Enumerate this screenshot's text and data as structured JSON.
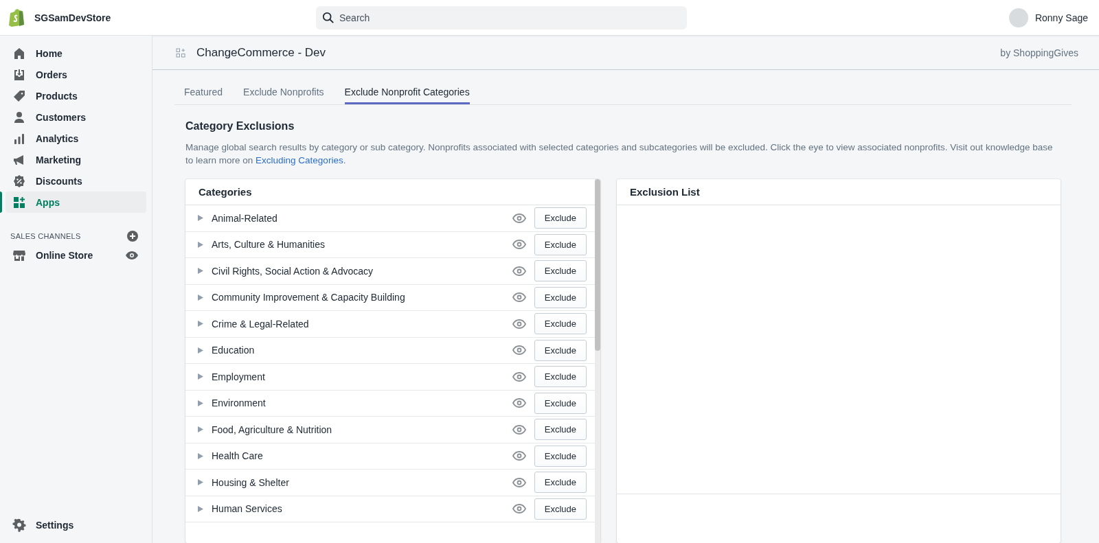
{
  "topbar": {
    "store_name": "SGSamDevStore",
    "search": {
      "placeholder": "Search"
    },
    "user_name": "Ronny Sage"
  },
  "sidebar": {
    "items": [
      {
        "label": "Home",
        "selected": false
      },
      {
        "label": "Orders",
        "selected": false
      },
      {
        "label": "Products",
        "selected": false
      },
      {
        "label": "Customers",
        "selected": false
      },
      {
        "label": "Analytics",
        "selected": false
      },
      {
        "label": "Marketing",
        "selected": false
      },
      {
        "label": "Discounts",
        "selected": false
      },
      {
        "label": "Apps",
        "selected": true
      }
    ],
    "sales_channels": {
      "heading": "SALES CHANNELS",
      "items": [
        {
          "label": "Online Store"
        }
      ]
    },
    "settings": {
      "label": "Settings"
    }
  },
  "app_header": {
    "title": "ChangeCommerce - Dev",
    "developer": "by ShoppingGives"
  },
  "tabs": [
    {
      "label": "Featured",
      "selected": false
    },
    {
      "label": "Exclude Nonprofits",
      "selected": false
    },
    {
      "label": "Exclude Nonprofit Categories",
      "selected": true
    }
  ],
  "section": {
    "title": "Category Exclusions",
    "description": "Manage global search results by category or sub category. Nonprofits associated with selected categories and subcategories will be excluded. Click the eye to view associated nonprofits. Visit out knowledge base to learn more on ",
    "link": "Excluding Categories",
    "after_link": "."
  },
  "categories": {
    "title": "Categories",
    "rows": [
      {
        "name": "Animal-Related",
        "button": "Exclude"
      },
      {
        "name": "Arts, Culture & Humanities",
        "button": "Exclude"
      },
      {
        "name": "Civil Rights, Social Action & Advocacy",
        "button": "Exclude"
      },
      {
        "name": "Community Improvement & Capacity Building",
        "button": "Exclude"
      },
      {
        "name": "Crime & Legal-Related",
        "button": "Exclude"
      },
      {
        "name": "Education",
        "button": "Exclude"
      },
      {
        "name": "Employment",
        "button": "Exclude"
      },
      {
        "name": "Environment",
        "button": "Exclude"
      },
      {
        "name": "Food, Agriculture & Nutrition",
        "button": "Exclude"
      },
      {
        "name": "Health Care",
        "button": "Exclude"
      },
      {
        "name": "Housing & Shelter",
        "button": "Exclude"
      },
      {
        "name": "Human Services",
        "button": "Exclude"
      }
    ]
  },
  "exclusion_list": {
    "title": "Exclusion List"
  }
}
